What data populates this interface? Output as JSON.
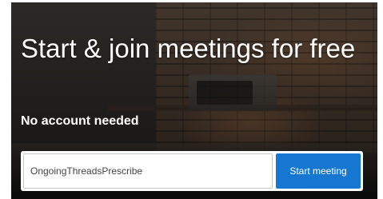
{
  "hero": {
    "headline": "Start & join meetings for free",
    "subheadline": "No account needed"
  },
  "meeting_form": {
    "input_value": "OngoingThreadsPrescribe",
    "button_label": "Start meeting"
  },
  "colors": {
    "button_background": "#1677d2",
    "headline_text": "#ffffff"
  }
}
